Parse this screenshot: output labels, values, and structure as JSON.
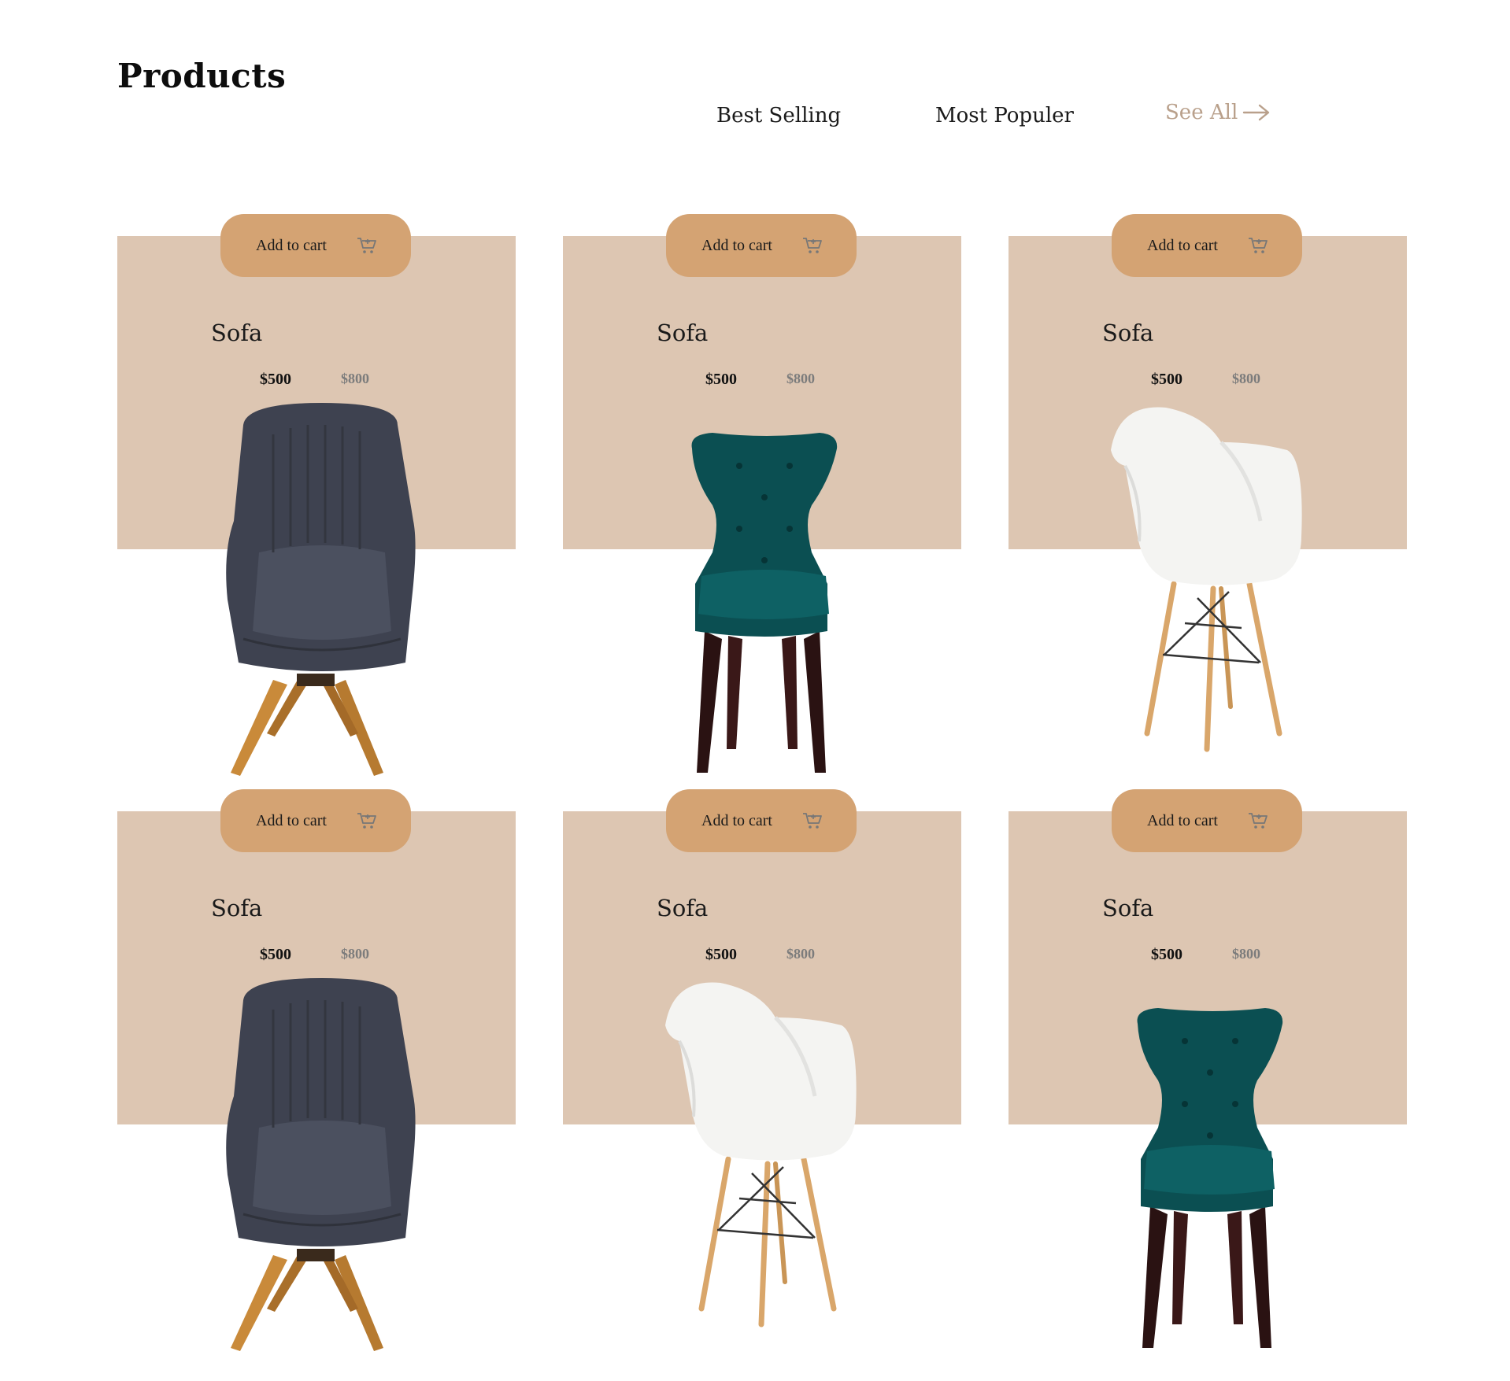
{
  "header": {
    "title": "Products",
    "tabs": [
      "Best Selling",
      "Most Populer"
    ],
    "see_all_label": "See All"
  },
  "colors": {
    "card_background": "#ddc6b2",
    "button_background": "#d4a373",
    "accent_text": "#b9a08b",
    "old_price": "#7c7c7c"
  },
  "products": [
    {
      "name": "Sofa",
      "price": "$500",
      "old_price": "$800",
      "cart_label": "Add to cart",
      "chair": "dark-gray-armchair"
    },
    {
      "name": "Sofa",
      "price": "$500",
      "old_price": "$800",
      "cart_label": "Add to cart",
      "chair": "teal-velvet-chair"
    },
    {
      "name": "Sofa",
      "price": "$500",
      "old_price": "$800",
      "cart_label": "Add to cart",
      "chair": "white-shell-chair"
    },
    {
      "name": "Sofa",
      "price": "$500",
      "old_price": "$800",
      "cart_label": "Add to cart",
      "chair": "dark-gray-armchair"
    },
    {
      "name": "Sofa",
      "price": "$500",
      "old_price": "$800",
      "cart_label": "Add to cart",
      "chair": "white-shell-chair"
    },
    {
      "name": "Sofa",
      "price": "$500",
      "old_price": "$800",
      "cart_label": "Add to cart",
      "chair": "teal-velvet-chair"
    }
  ]
}
